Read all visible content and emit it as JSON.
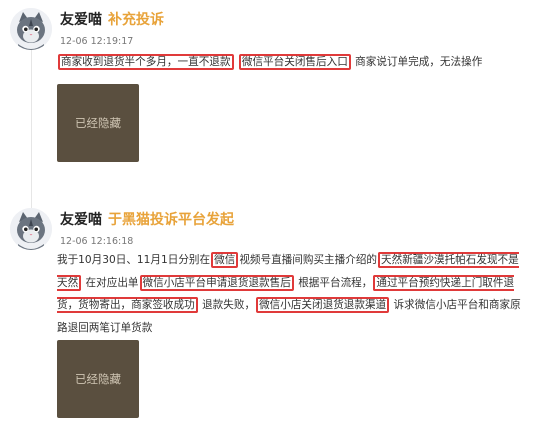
{
  "entries": [
    {
      "user": "友爱喵",
      "action": "补充投诉",
      "timestamp": "12-06 12:19:17",
      "segments": [
        {
          "text": "商家收到退货半个多月，一直不退款",
          "hl": true
        },
        {
          "text": " ",
          "hl": false
        },
        {
          "text": "微信平台关闭售后入口",
          "hl": true
        },
        {
          "text": "  商家说订单完成，无法操作",
          "hl": false
        }
      ],
      "image_label": "已经隐藏"
    },
    {
      "user": "友爱喵",
      "action": "于黑猫投诉平台发起",
      "timestamp": "12-06 12:16:18",
      "segments": [
        {
          "text": "我于10月30日、11月1日分别在",
          "hl": false
        },
        {
          "text": "微信",
          "hl": true
        },
        {
          "text": "视频号直播间购买主播介绍的",
          "hl": false
        },
        {
          "text": "天然新疆沙漠托帕石发现不是天然",
          "hl": true
        },
        {
          "text": "  在对应出单",
          "hl": false
        },
        {
          "text": "微信小店平台申请退货退款售后",
          "hl": true
        },
        {
          "text": "  根据平台流程，",
          "hl": false
        },
        {
          "text": "通过平台预约快递上门取件退货，货物寄出，商家签收成功",
          "hl": true
        },
        {
          "text": "  退款失败，",
          "hl": false
        },
        {
          "text": "微信小店关闭退货退款渠道",
          "hl": true
        },
        {
          "text": "  诉求微信小店平台和商家原路退回两笔订单货款",
          "hl": false
        }
      ],
      "image_label": "已经隐藏"
    }
  ]
}
